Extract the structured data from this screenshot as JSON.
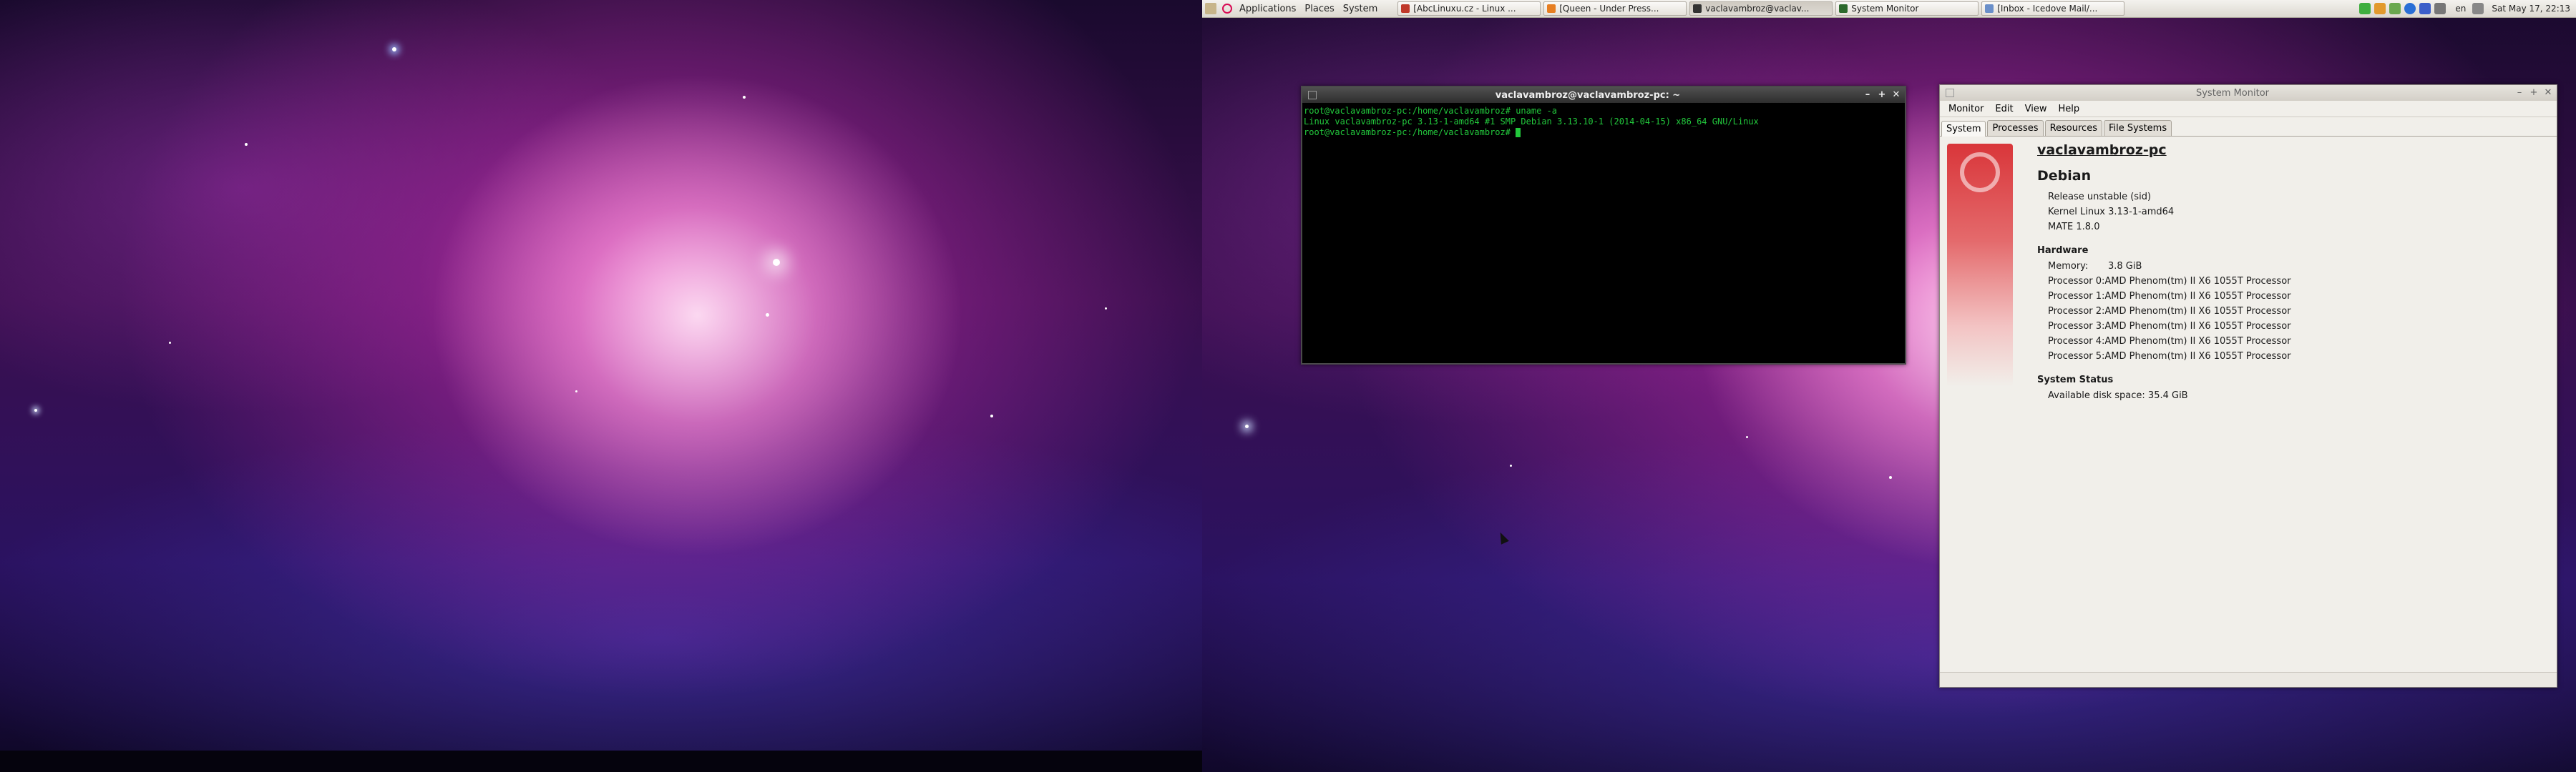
{
  "panel": {
    "menus": [
      "Applications",
      "Places",
      "System"
    ],
    "tasks": [
      {
        "label": "[AbcLinuxu.cz - Linux ...",
        "active": false,
        "icon_color": "#c0392b"
      },
      {
        "label": "[Queen - Under Press...",
        "active": false,
        "icon_color": "#e67e22"
      },
      {
        "label": "vaclavambroz@vaclav...",
        "active": true,
        "icon_color": "#333333"
      },
      {
        "label": "System Monitor",
        "active": false,
        "icon_color": "#2d6a2d"
      },
      {
        "label": "[Inbox - Icedove Mail/...",
        "active": false,
        "icon_color": "#6a8fc9"
      }
    ],
    "keyboard_layout": "en",
    "clock": "Sat May 17, 22:13"
  },
  "terminal": {
    "title": "vaclavambroz@vaclavambroz-pc: ~",
    "lines": [
      "root@vaclavambroz-pc:/home/vaclavambroz# uname -a",
      "Linux vaclavambroz-pc 3.13-1-amd64 #1 SMP Debian 3.13.10-1 (2014-04-15) x86_64 GNU/Linux",
      "root@vaclavambroz-pc:/home/vaclavambroz# "
    ]
  },
  "sysmon": {
    "title": "System Monitor",
    "menu": [
      "Monitor",
      "Edit",
      "View",
      "Help"
    ],
    "tabs": [
      "System",
      "Processes",
      "Resources",
      "File Systems"
    ],
    "hostname": "vaclavambroz-pc",
    "distro": "Debian",
    "release": "Release unstable (sid)",
    "kernel": "Kernel Linux 3.13-1-amd64",
    "desktop": "MATE 1.8.0",
    "hardware_heading": "Hardware",
    "memory_label": "Memory:",
    "memory_value": "3.8 GiB",
    "processors": [
      {
        "label": "Processor 0:",
        "value": "AMD Phenom(tm) II X6 1055T Processor"
      },
      {
        "label": "Processor 1:",
        "value": "AMD Phenom(tm) II X6 1055T Processor"
      },
      {
        "label": "Processor 2:",
        "value": "AMD Phenom(tm) II X6 1055T Processor"
      },
      {
        "label": "Processor 3:",
        "value": "AMD Phenom(tm) II X6 1055T Processor"
      },
      {
        "label": "Processor 4:",
        "value": "AMD Phenom(tm) II X6 1055T Processor"
      },
      {
        "label": "Processor 5:",
        "value": "AMD Phenom(tm) II X6 1055T Processor"
      }
    ],
    "status_heading": "System Status",
    "disk_space": "Available disk space: 35.4 GiB"
  },
  "colors": {
    "terminal_text": "#22c83c",
    "logo_red": "#d9363a"
  }
}
